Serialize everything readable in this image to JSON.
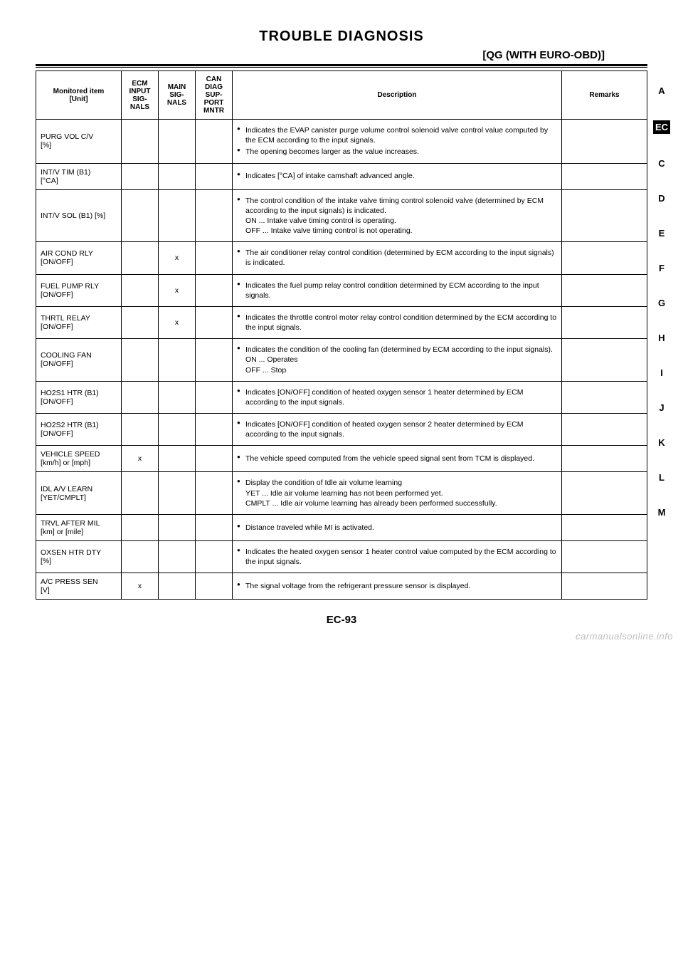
{
  "header": {
    "title": "TROUBLE DIAGNOSIS",
    "subtitle": "[QG (WITH EURO-OBD)]"
  },
  "sidebar": {
    "items": [
      "A",
      "EC",
      "C",
      "D",
      "E",
      "F",
      "G",
      "H",
      "I",
      "J",
      "K",
      "L",
      "M"
    ],
    "active": "EC"
  },
  "table": {
    "headers": {
      "monitored": "Monitored item\n[Unit]",
      "ecm": "ECM\nINPUT\nSIG-\nNALS",
      "main": "MAIN\nSIG-\nNALS",
      "can": "CAN\nDIAG\nSUP-\nPORT\nMNTR",
      "desc": "Description",
      "rem": "Remarks"
    },
    "rows": [
      {
        "item": "PURG VOL C/V\n[%]",
        "ecm": "",
        "main": "",
        "can": "",
        "desc": [
          "Indicates the EVAP canister purge volume control solenoid valve control value computed by the ECM according to the input signals.",
          "The opening becomes larger as the value increases."
        ],
        "rem": ""
      },
      {
        "item": "INT/V TIM (B1)\n[°CA]",
        "ecm": "",
        "main": "",
        "can": "",
        "desc": [
          "Indicates [°CA] of intake camshaft advanced angle."
        ],
        "rem": ""
      },
      {
        "item": "INT/V SOL (B1) [%]",
        "ecm": "",
        "main": "",
        "can": "",
        "desc": [
          "The control condition of the intake valve timing control solenoid valve (determined by ECM according to the input signals) is indicated.\nON ... Intake valve timing control is operating.\nOFF ... Intake valve timing control is not operating."
        ],
        "rem": ""
      },
      {
        "item": "AIR COND RLY\n[ON/OFF]",
        "ecm": "",
        "main": "x",
        "can": "",
        "desc": [
          "The air conditioner relay control condition (determined by ECM according to the input signals) is indicated."
        ],
        "rem": ""
      },
      {
        "item": "FUEL PUMP RLY\n[ON/OFF]",
        "ecm": "",
        "main": "x",
        "can": "",
        "desc": [
          "Indicates the fuel pump relay control condition determined by ECM according to the input signals."
        ],
        "rem": ""
      },
      {
        "item": "THRTL RELAY\n[ON/OFF]",
        "ecm": "",
        "main": "x",
        "can": "",
        "desc": [
          "Indicates the throttle control motor relay control condition determined by the ECM according to the input signals."
        ],
        "rem": ""
      },
      {
        "item": "COOLING FAN\n[ON/OFF]",
        "ecm": "",
        "main": "",
        "can": "",
        "desc": [
          "Indicates the condition of the cooling fan (determined by ECM according to the input signals).\nON ... Operates\nOFF ... Stop"
        ],
        "rem": ""
      },
      {
        "item": "HO2S1 HTR (B1)\n[ON/OFF]",
        "ecm": "",
        "main": "",
        "can": "",
        "desc": [
          "Indicates [ON/OFF] condition of heated oxygen sensor 1 heater determined by ECM according to the input signals."
        ],
        "rem": ""
      },
      {
        "item": "HO2S2 HTR (B1)\n[ON/OFF]",
        "ecm": "",
        "main": "",
        "can": "",
        "desc": [
          "Indicates [ON/OFF] condition of heated oxygen sensor 2 heater determined by ECM according to the input signals."
        ],
        "rem": ""
      },
      {
        "item": "VEHICLE SPEED\n[km/h] or [mph]",
        "ecm": "x",
        "main": "",
        "can": "",
        "desc": [
          "The vehicle speed computed from the vehicle speed signal sent from TCM is displayed."
        ],
        "rem": ""
      },
      {
        "item": "IDL A/V LEARN\n[YET/CMPLT]",
        "ecm": "",
        "main": "",
        "can": "",
        "desc": [
          "Display the condition of Idle air volume learning\nYET ... Idle air volume learning has not been performed yet.\nCMPLT ... Idle air volume learning has already been performed successfully."
        ],
        "rem": ""
      },
      {
        "item": "TRVL AFTER MIL\n[km] or [mile]",
        "ecm": "",
        "main": "",
        "can": "",
        "desc": [
          "Distance traveled while MI is activated."
        ],
        "rem": ""
      },
      {
        "item": "OXSEN HTR DTY\n[%]",
        "ecm": "",
        "main": "",
        "can": "",
        "desc": [
          "Indicates the heated oxygen sensor 1 heater control value computed by the ECM according to the input signals."
        ],
        "rem": ""
      },
      {
        "item": "A/C PRESS SEN\n[V]",
        "ecm": "x",
        "main": "",
        "can": "",
        "desc": [
          "The signal voltage from the refrigerant pressure sensor is displayed."
        ],
        "rem": ""
      }
    ]
  },
  "footer": {
    "pageref": "EC-93",
    "watermark": "carmanualsonline.info"
  }
}
